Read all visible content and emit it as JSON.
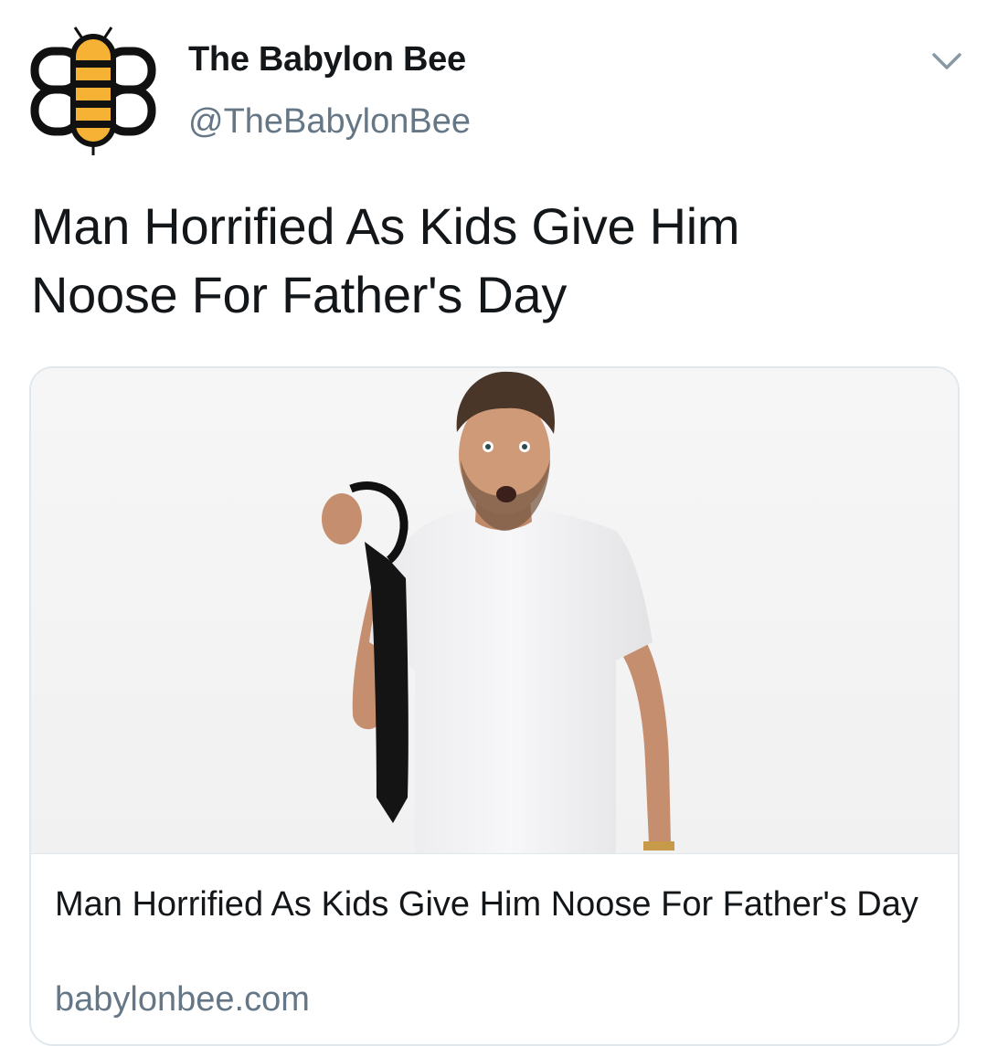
{
  "account": {
    "name": "The Babylon Bee",
    "handle": "@TheBabylonBee",
    "avatar_icon": "bee-logo-icon"
  },
  "tweet": {
    "text_line1": "Man Horrified As Kids Give Him",
    "text_line2": "Noose For Father's Day"
  },
  "card": {
    "image_icon": "man-holding-necktie-photo",
    "title": "Man Horrified As Kids Give Him Noose For Father's Day",
    "domain": "babylonbee.com"
  },
  "colors": {
    "text": "#14171a",
    "secondary": "#657786",
    "border": "#e1e8ed",
    "bee_yellow": "#f5b235"
  },
  "menu_icon": "chevron-down-icon"
}
